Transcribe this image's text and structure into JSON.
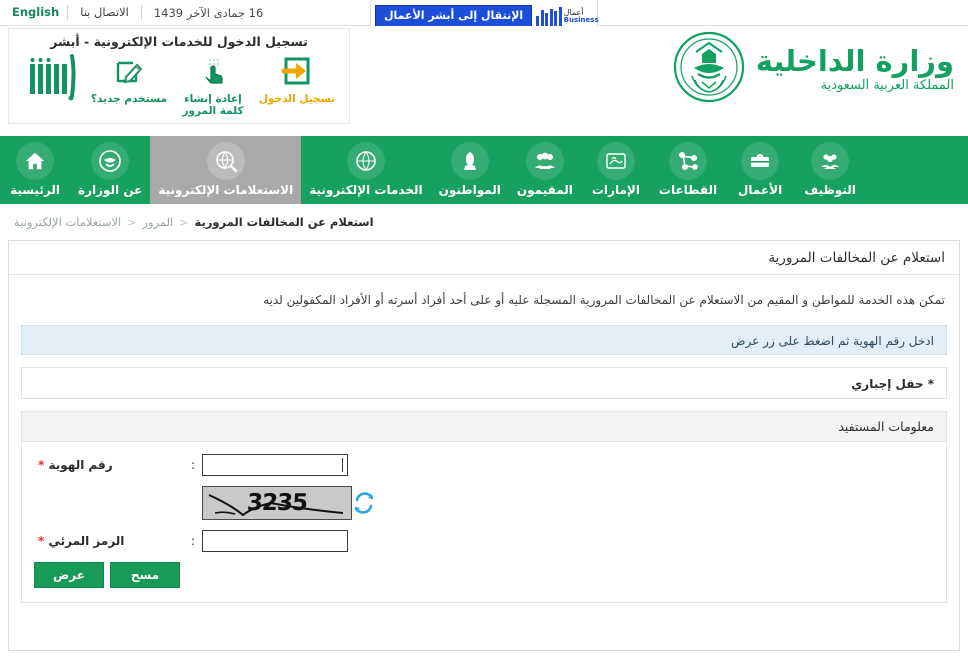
{
  "topbar": {
    "english_label": "English",
    "contact_label": "الاتصال بنا",
    "date": "16 جمادى الآخر 1439"
  },
  "business_banner": {
    "button_label": "الإنتقال إلى أبشر الأعمال",
    "logo_ar": "أعمال",
    "logo_en": "Business"
  },
  "login_box": {
    "title": "تسجيل الدخول للخدمات الإلكترونية - أبشر",
    "items": [
      {
        "label": "تسجيل الدخول",
        "icon": "login-arrow-icon"
      },
      {
        "label": "إعادة إنشاء كلمة المرور",
        "icon": "hand-pointer-icon"
      },
      {
        "label": "مستخدم جديد؟",
        "icon": "edit-document-icon"
      }
    ],
    "brand_mark": "abshr-logo"
  },
  "ministry": {
    "name_ar": "وزارة الداخلية",
    "country_ar": "المملكة العربية السعودية",
    "emblem": "saudi-moi-emblem-icon"
  },
  "nav": {
    "items": [
      {
        "label": "الرئيسية",
        "icon": "home-icon",
        "active": false
      },
      {
        "label": "عن الوزارة",
        "icon": "emblem-icon",
        "active": false
      },
      {
        "label": "الاستعلامات الإلكترونية",
        "icon": "search-globe-icon",
        "active": true
      },
      {
        "label": "الخدمات الإلكترونية",
        "icon": "globe-icon",
        "active": false
      },
      {
        "label": "المواطنون",
        "icon": "citizen-icon",
        "active": false
      },
      {
        "label": "المقيمون",
        "icon": "residents-icon",
        "active": false
      },
      {
        "label": "الإمارات",
        "icon": "emirates-icon",
        "active": false
      },
      {
        "label": "القطاعات",
        "icon": "sectors-icon",
        "active": false
      },
      {
        "label": "الأعمال",
        "icon": "business-case-icon",
        "active": false
      },
      {
        "label": "التوظيف",
        "icon": "employment-icon",
        "active": false
      }
    ]
  },
  "breadcrumb": {
    "items": [
      "الاستعلامات الإلكترونية",
      "المرور",
      "استعلام عن المخالفات المرورية"
    ],
    "separator": "<"
  },
  "page": {
    "title": "استعلام عن المخالفات المرورية",
    "description": "تمكن هذه الخدمة للمواطن و المقيم من الاستعلام عن المخالفات المرورية المسجلة عليه أو على أحد أفراد أسرته أو الأفراد المكفولين لديه",
    "notice": "ادخل رقم الهوية ثم اضغط على زر عرض",
    "required_note": "* حقل إجباري"
  },
  "form": {
    "section_title": "معلومات المستفيد",
    "colon": ":",
    "id_field": {
      "label": "رقم الهوية",
      "required_mark": "*",
      "value": "",
      "placeholder": ""
    },
    "captcha": {
      "text": "3235",
      "refresh_icon": "refresh-icon"
    },
    "code_field": {
      "label": "الرمز المرئي",
      "required_mark": "*",
      "value": "",
      "placeholder": ""
    },
    "buttons": {
      "submit": "عرض",
      "clear": "مسح"
    }
  },
  "colors": {
    "brand_green": "#17a05e",
    "button_green": "#199b58",
    "active_tab_gray": "#a9a9a9",
    "notice_blue": "#e2eff8",
    "banner_blue": "#1d4ed8"
  }
}
